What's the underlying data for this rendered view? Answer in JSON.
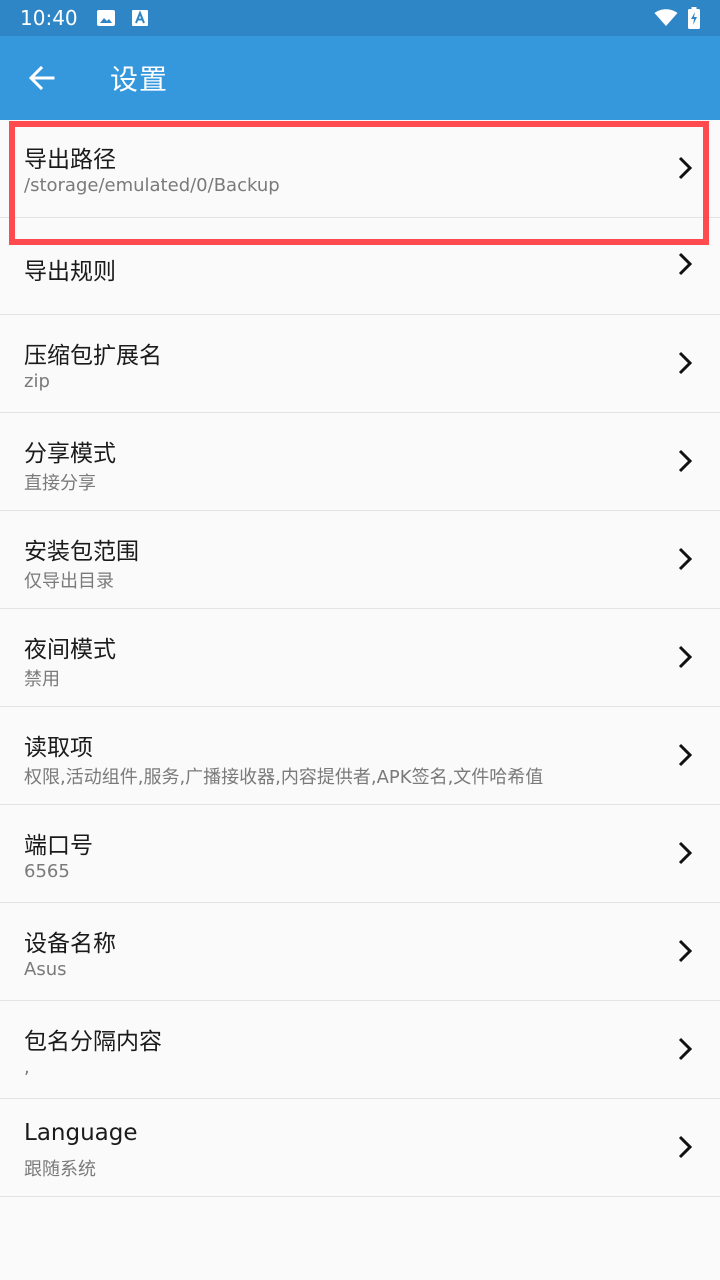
{
  "status_bar": {
    "time": "10:40",
    "icons": [
      "image-icon",
      "a-icon",
      "wifi-icon",
      "battery-charging-icon"
    ]
  },
  "app_bar": {
    "title": "设置",
    "back_icon": "arrow-left-icon"
  },
  "settings": [
    {
      "title": "导出路径",
      "subtitle": "/storage/emulated/0/Backup"
    },
    {
      "title": "导出规则",
      "subtitle": ""
    },
    {
      "title": "压缩包扩展名",
      "subtitle": "zip"
    },
    {
      "title": "分享模式",
      "subtitle": "直接分享"
    },
    {
      "title": "安装包范围",
      "subtitle": "仅导出目录"
    },
    {
      "title": "夜间模式",
      "subtitle": "禁用"
    },
    {
      "title": "读取项",
      "subtitle": "权限,活动组件,服务,广播接收器,内容提供者,APK签名,文件哈希值"
    },
    {
      "title": "端口号",
      "subtitle": "6565"
    },
    {
      "title": "设备名称",
      "subtitle": "Asus"
    },
    {
      "title": "包名分隔内容",
      "subtitle": ","
    },
    {
      "title": "Language",
      "subtitle": "跟随系统"
    }
  ],
  "colors": {
    "status_bar": "#2f86c6",
    "app_bar": "#3597dc",
    "highlight": "#ff4b4f"
  }
}
